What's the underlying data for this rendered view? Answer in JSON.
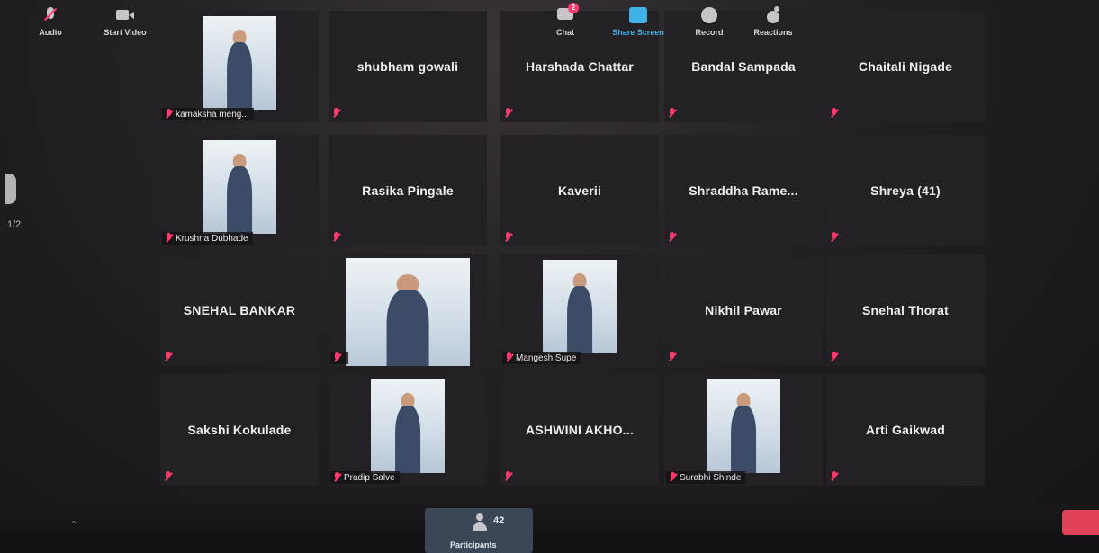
{
  "meeting": {
    "page_indicator": "1/2",
    "participants_grid": [
      {
        "name": "kamaksha meng...",
        "video": true,
        "row": 0,
        "col": 0
      },
      {
        "name": "shubham gowali",
        "video": false,
        "row": 0,
        "col": 1
      },
      {
        "name": "Harshada Chattar",
        "video": false,
        "row": 0,
        "col": 2
      },
      {
        "name": "Bandal Sampada",
        "video": false,
        "row": 0,
        "col": 3
      },
      {
        "name": "Chaitali Nigade",
        "video": false,
        "row": 0,
        "col": 4
      },
      {
        "name": "Krushna Dubhade",
        "video": true,
        "row": 1,
        "col": 0
      },
      {
        "name": "Rasika Pingale",
        "video": false,
        "row": 1,
        "col": 1
      },
      {
        "name": "Kaverii",
        "video": false,
        "row": 1,
        "col": 2
      },
      {
        "name": "Shraddha  Rame...",
        "video": false,
        "row": 1,
        "col": 3
      },
      {
        "name": "Shreya (41)",
        "video": false,
        "row": 1,
        "col": 4
      },
      {
        "name": "SNEHAL  BANKAR",
        "video": false,
        "row": 2,
        "col": 0
      },
      {
        "name": "",
        "video": true,
        "wide": true,
        "row": 2,
        "col": 1
      },
      {
        "name": "Mangesh Supe",
        "video": true,
        "row": 2,
        "col": 2
      },
      {
        "name": "Nikhil Pawar",
        "video": false,
        "row": 2,
        "col": 3
      },
      {
        "name": "Snehal Thorat",
        "video": false,
        "row": 2,
        "col": 4
      },
      {
        "name": "Sakshi Kokulade",
        "video": false,
        "row": 3,
        "col": 0
      },
      {
        "name": "Pradip Salve",
        "video": true,
        "row": 3,
        "col": 1
      },
      {
        "name": "ASHWINI  AKHO...",
        "video": false,
        "row": 3,
        "col": 2
      },
      {
        "name": "Surabhi Shinde",
        "video": true,
        "row": 3,
        "col": 3
      },
      {
        "name": "Arti Gaikwad",
        "video": false,
        "row": 3,
        "col": 4
      }
    ]
  },
  "toolbar": {
    "audio_label": "Audio",
    "video_label": "Start Video",
    "participants_label": "Participants",
    "participants_count": "42",
    "chat_label": "Chat",
    "chat_badge": "2",
    "share_label": "Share Screen",
    "record_label": "Record",
    "reactions_label": "Reactions",
    "caret": "^"
  },
  "colors": {
    "accent_share": "#3fb3e8",
    "mute_red": "#ff3b6e",
    "end_button": "#e2415a",
    "participants_bg": "#3b4656"
  },
  "icons": [
    "mic-muted-icon",
    "camera-icon",
    "participants-icon",
    "chat-icon",
    "share-screen-icon",
    "record-icon",
    "reactions-icon",
    "page-next-icon"
  ]
}
